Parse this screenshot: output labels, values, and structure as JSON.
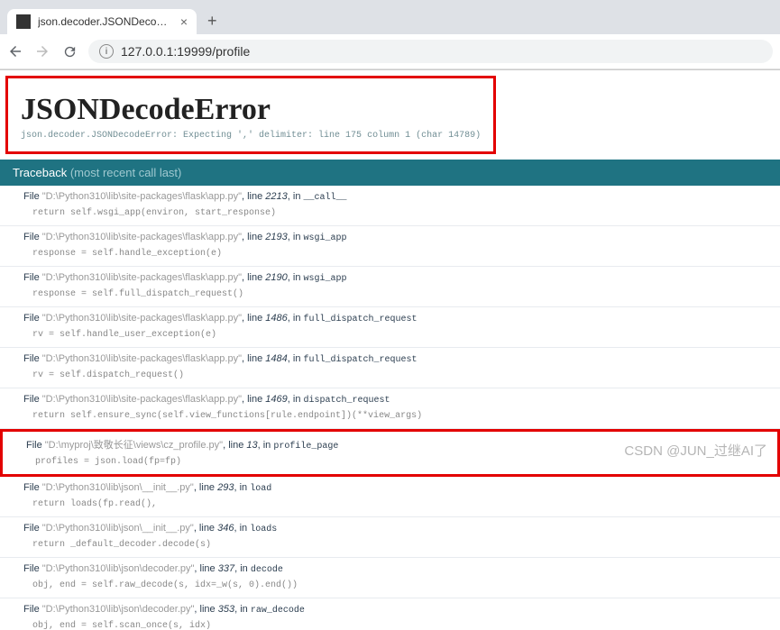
{
  "browser": {
    "tab_title": "json.decoder.JSONDecodeErro",
    "url": "127.0.0.1:19999/profile"
  },
  "error": {
    "title": "JSONDecodeError",
    "message": "json.decoder.JSONDecodeError: Expecting ',' delimiter: line 175 column 1 (char 14789)"
  },
  "traceback_header": {
    "label": "Traceback",
    "hint": "(most recent call last)"
  },
  "frames": [
    {
      "file": "D:\\Python310\\lib\\site-packages\\flask\\app.py",
      "line": "2213",
      "func": "__call__",
      "code": "return self.wsgi_app(environ, start_response)",
      "hl": false
    },
    {
      "file": "D:\\Python310\\lib\\site-packages\\flask\\app.py",
      "line": "2193",
      "func": "wsgi_app",
      "code": "response = self.handle_exception(e)",
      "hl": false
    },
    {
      "file": "D:\\Python310\\lib\\site-packages\\flask\\app.py",
      "line": "2190",
      "func": "wsgi_app",
      "code": "response = self.full_dispatch_request()",
      "hl": false
    },
    {
      "file": "D:\\Python310\\lib\\site-packages\\flask\\app.py",
      "line": "1486",
      "func": "full_dispatch_request",
      "code": "rv = self.handle_user_exception(e)",
      "hl": false
    },
    {
      "file": "D:\\Python310\\lib\\site-packages\\flask\\app.py",
      "line": "1484",
      "func": "full_dispatch_request",
      "code": "rv = self.dispatch_request()",
      "hl": false
    },
    {
      "file": "D:\\Python310\\lib\\site-packages\\flask\\app.py",
      "line": "1469",
      "func": "dispatch_request",
      "code": "return self.ensure_sync(self.view_functions[rule.endpoint])(**view_args)",
      "hl": false
    },
    {
      "file": "D:\\myproj\\致敬长征\\views\\cz_profile.py",
      "line": "13",
      "func": "profile_page",
      "code": "profiles = json.load(fp=fp)",
      "hl": true
    },
    {
      "file": "D:\\Python310\\lib\\json\\__init__.py",
      "line": "293",
      "func": "load",
      "code": "return loads(fp.read(),",
      "hl": false
    },
    {
      "file": "D:\\Python310\\lib\\json\\__init__.py",
      "line": "346",
      "func": "loads",
      "code": "return _default_decoder.decode(s)",
      "hl": false
    },
    {
      "file": "D:\\Python310\\lib\\json\\decoder.py",
      "line": "337",
      "func": "decode",
      "code": "obj, end = self.raw_decode(s, idx=_w(s, 0).end())",
      "hl": false
    },
    {
      "file": "D:\\Python310\\lib\\json\\decoder.py",
      "line": "353",
      "func": "raw_decode",
      "code": "obj, end = self.scan_once(s, idx)",
      "hl": false
    }
  ],
  "watermark": "CSDN @JUN_过继AI了"
}
